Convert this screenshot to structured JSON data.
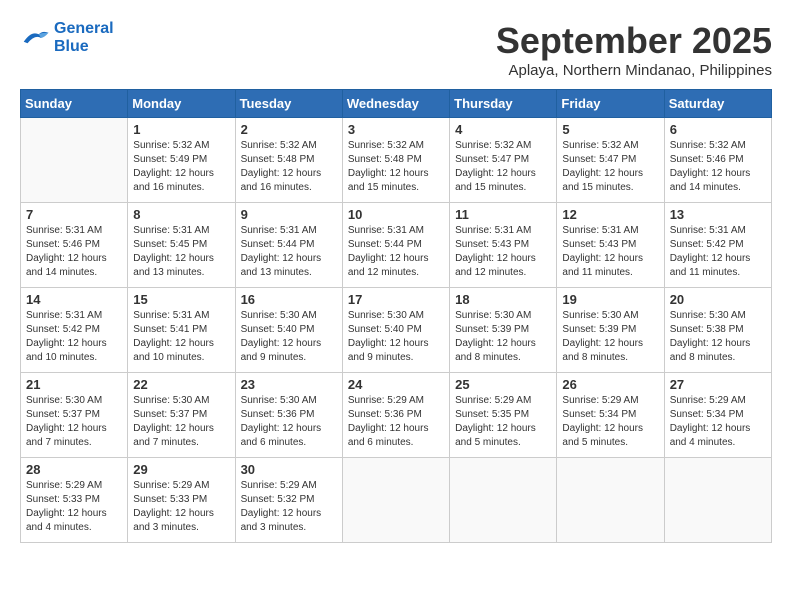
{
  "header": {
    "logo_line1": "General",
    "logo_line2": "Blue",
    "month": "September 2025",
    "location": "Aplaya, Northern Mindanao, Philippines"
  },
  "days_of_week": [
    "Sunday",
    "Monday",
    "Tuesday",
    "Wednesday",
    "Thursday",
    "Friday",
    "Saturday"
  ],
  "weeks": [
    [
      {
        "day": "",
        "info": ""
      },
      {
        "day": "1",
        "info": "Sunrise: 5:32 AM\nSunset: 5:49 PM\nDaylight: 12 hours\nand 16 minutes."
      },
      {
        "day": "2",
        "info": "Sunrise: 5:32 AM\nSunset: 5:48 PM\nDaylight: 12 hours\nand 16 minutes."
      },
      {
        "day": "3",
        "info": "Sunrise: 5:32 AM\nSunset: 5:48 PM\nDaylight: 12 hours\nand 15 minutes."
      },
      {
        "day": "4",
        "info": "Sunrise: 5:32 AM\nSunset: 5:47 PM\nDaylight: 12 hours\nand 15 minutes."
      },
      {
        "day": "5",
        "info": "Sunrise: 5:32 AM\nSunset: 5:47 PM\nDaylight: 12 hours\nand 15 minutes."
      },
      {
        "day": "6",
        "info": "Sunrise: 5:32 AM\nSunset: 5:46 PM\nDaylight: 12 hours\nand 14 minutes."
      }
    ],
    [
      {
        "day": "7",
        "info": "Sunrise: 5:31 AM\nSunset: 5:46 PM\nDaylight: 12 hours\nand 14 minutes."
      },
      {
        "day": "8",
        "info": "Sunrise: 5:31 AM\nSunset: 5:45 PM\nDaylight: 12 hours\nand 13 minutes."
      },
      {
        "day": "9",
        "info": "Sunrise: 5:31 AM\nSunset: 5:44 PM\nDaylight: 12 hours\nand 13 minutes."
      },
      {
        "day": "10",
        "info": "Sunrise: 5:31 AM\nSunset: 5:44 PM\nDaylight: 12 hours\nand 12 minutes."
      },
      {
        "day": "11",
        "info": "Sunrise: 5:31 AM\nSunset: 5:43 PM\nDaylight: 12 hours\nand 12 minutes."
      },
      {
        "day": "12",
        "info": "Sunrise: 5:31 AM\nSunset: 5:43 PM\nDaylight: 12 hours\nand 11 minutes."
      },
      {
        "day": "13",
        "info": "Sunrise: 5:31 AM\nSunset: 5:42 PM\nDaylight: 12 hours\nand 11 minutes."
      }
    ],
    [
      {
        "day": "14",
        "info": "Sunrise: 5:31 AM\nSunset: 5:42 PM\nDaylight: 12 hours\nand 10 minutes."
      },
      {
        "day": "15",
        "info": "Sunrise: 5:31 AM\nSunset: 5:41 PM\nDaylight: 12 hours\nand 10 minutes."
      },
      {
        "day": "16",
        "info": "Sunrise: 5:30 AM\nSunset: 5:40 PM\nDaylight: 12 hours\nand 9 minutes."
      },
      {
        "day": "17",
        "info": "Sunrise: 5:30 AM\nSunset: 5:40 PM\nDaylight: 12 hours\nand 9 minutes."
      },
      {
        "day": "18",
        "info": "Sunrise: 5:30 AM\nSunset: 5:39 PM\nDaylight: 12 hours\nand 8 minutes."
      },
      {
        "day": "19",
        "info": "Sunrise: 5:30 AM\nSunset: 5:39 PM\nDaylight: 12 hours\nand 8 minutes."
      },
      {
        "day": "20",
        "info": "Sunrise: 5:30 AM\nSunset: 5:38 PM\nDaylight: 12 hours\nand 8 minutes."
      }
    ],
    [
      {
        "day": "21",
        "info": "Sunrise: 5:30 AM\nSunset: 5:37 PM\nDaylight: 12 hours\nand 7 minutes."
      },
      {
        "day": "22",
        "info": "Sunrise: 5:30 AM\nSunset: 5:37 PM\nDaylight: 12 hours\nand 7 minutes."
      },
      {
        "day": "23",
        "info": "Sunrise: 5:30 AM\nSunset: 5:36 PM\nDaylight: 12 hours\nand 6 minutes."
      },
      {
        "day": "24",
        "info": "Sunrise: 5:29 AM\nSunset: 5:36 PM\nDaylight: 12 hours\nand 6 minutes."
      },
      {
        "day": "25",
        "info": "Sunrise: 5:29 AM\nSunset: 5:35 PM\nDaylight: 12 hours\nand 5 minutes."
      },
      {
        "day": "26",
        "info": "Sunrise: 5:29 AM\nSunset: 5:34 PM\nDaylight: 12 hours\nand 5 minutes."
      },
      {
        "day": "27",
        "info": "Sunrise: 5:29 AM\nSunset: 5:34 PM\nDaylight: 12 hours\nand 4 minutes."
      }
    ],
    [
      {
        "day": "28",
        "info": "Sunrise: 5:29 AM\nSunset: 5:33 PM\nDaylight: 12 hours\nand 4 minutes."
      },
      {
        "day": "29",
        "info": "Sunrise: 5:29 AM\nSunset: 5:33 PM\nDaylight: 12 hours\nand 3 minutes."
      },
      {
        "day": "30",
        "info": "Sunrise: 5:29 AM\nSunset: 5:32 PM\nDaylight: 12 hours\nand 3 minutes."
      },
      {
        "day": "",
        "info": ""
      },
      {
        "day": "",
        "info": ""
      },
      {
        "day": "",
        "info": ""
      },
      {
        "day": "",
        "info": ""
      }
    ]
  ]
}
